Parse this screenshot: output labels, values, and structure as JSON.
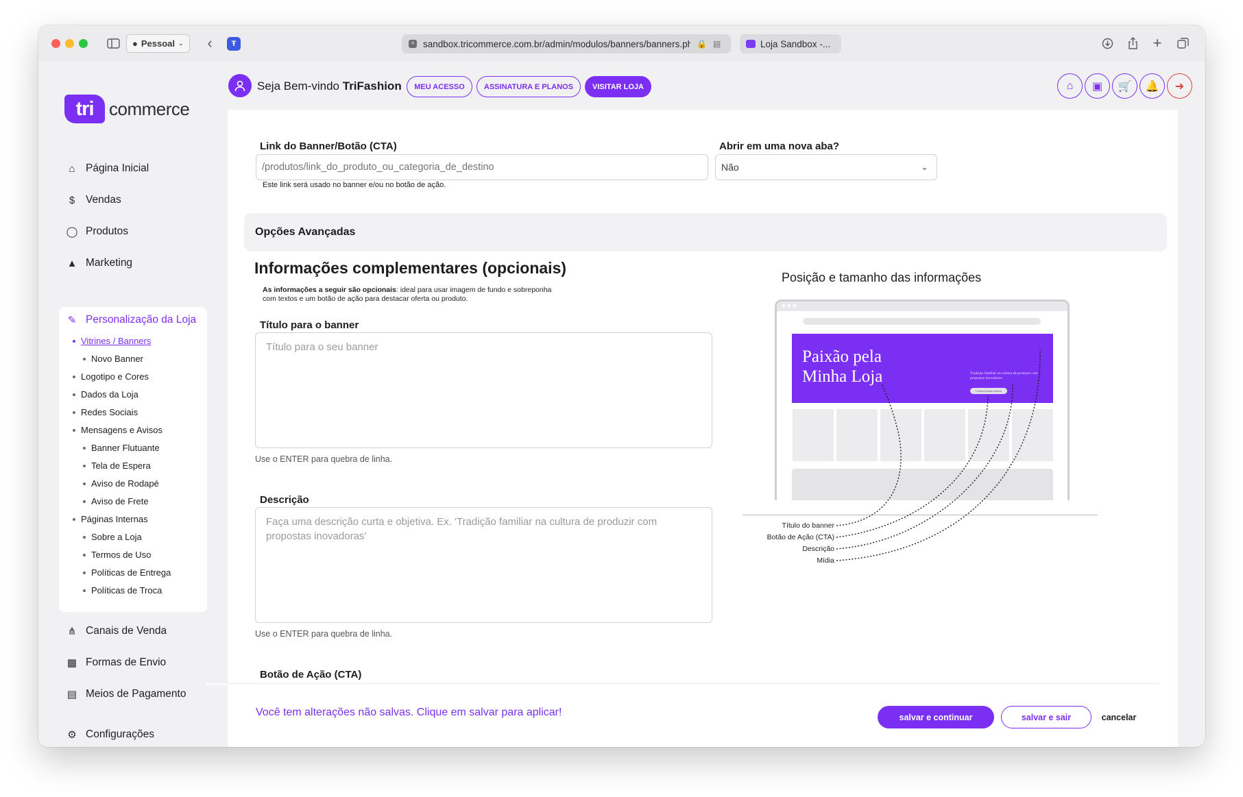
{
  "browser": {
    "profile_label": "Pessoal",
    "url": "sandbox.tricommerce.com.br/admin/modulos/banners/banners.ph",
    "second_tab_title": "Loja Sandbox -..."
  },
  "brand": {
    "logo_mark": "tri",
    "logo_text": "commerce",
    "accent_color": "#7b2ff2"
  },
  "header": {
    "welcome_prefix": "Seja Bem-vindo",
    "store_name": "TriFashion",
    "buttons": [
      "MEU ACESSO",
      "ASSINATURA E PLANOS",
      "VISITAR LOJA"
    ],
    "icons": [
      "home-icon",
      "bag-icon",
      "cart-icon",
      "bell-icon",
      "logout-icon"
    ]
  },
  "sidebar": {
    "items": [
      {
        "label": "Página Inicial",
        "icon": "home-icon"
      },
      {
        "label": "Vendas",
        "icon": "dollar-icon"
      },
      {
        "label": "Produtos",
        "icon": "tag-icon"
      },
      {
        "label": "Marketing",
        "icon": "megaphone-icon"
      },
      {
        "label": "Personalização da Loja",
        "icon": "edit-icon"
      },
      {
        "label": "Canais de Venda",
        "icon": "share-icon"
      },
      {
        "label": "Formas de Envio",
        "icon": "truck-icon"
      },
      {
        "label": "Meios de Pagamento",
        "icon": "card-icon"
      },
      {
        "label": "Configurações",
        "icon": "gear-icon"
      }
    ],
    "subitems": [
      "Vitrines / Banners",
      "Novo Banner",
      "Logotipo e Cores",
      "Dados da Loja",
      "Redes Sociais",
      "Mensagens e Avisos",
      "Banner Flutuante",
      "Tela de Espera",
      "Aviso de Rodapé",
      "Aviso de Frete",
      "Páginas Internas",
      "Sobre a Loja",
      "Termos de Uso",
      "Políticas de Entrega",
      "Políticas de Troca"
    ]
  },
  "form": {
    "link_label": "Link do Banner/Botão (CTA)",
    "link_placeholder": "/produtos/link_do_produto_ou_categoria_de_destino",
    "link_hint": "Este link será usado no banner e/ou no botão de ação.",
    "newtab_label": "Abrir em uma nova aba?",
    "newtab_value": "Não",
    "advanced_title": "Opções Avançadas",
    "section_title": "Informações complementares (opcionais)",
    "section_desc_bold": "As informações a seguir são opcionais",
    "section_desc_rest": ": ideal para usar imagem de fundo e sobreponha com textos e um botão de ação para destacar oferta ou produto.",
    "title_label": "Título para o banner",
    "title_placeholder": "Título para o seu banner",
    "title_hint": "Use o ENTER para quebra de linha.",
    "desc_label": "Descrição",
    "desc_placeholder": "Faça uma descrição curta e objetiva. Ex. 'Tradição familiar na cultura de produzir com propostas inovadoras'",
    "desc_hint": "Use o ENTER para quebra de linha.",
    "cta_label": "Botão de Ação (CTA)"
  },
  "illustration": {
    "title": "Posição e tamanho das informações",
    "banner_title": "Paixão pela Minha Loja",
    "banner_desc": "Tradição familiar na cultura de produzir com propostas inovadoras",
    "banner_button": "Conheça Nossa História",
    "legend": [
      "Título do banner",
      "Botão de Ação (CTA)",
      "Descrição",
      "Mídia"
    ]
  },
  "footer": {
    "unsaved_message": "Você tem alterações não salvas. Clique em salvar para aplicar!",
    "save_continue": "salvar e continuar",
    "save_exit": "salvar e sair",
    "cancel": "cancelar"
  }
}
